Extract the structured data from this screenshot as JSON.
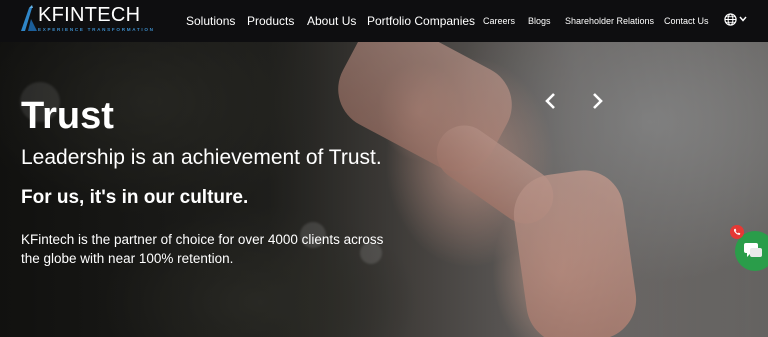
{
  "brand": {
    "name": "KFINTECH",
    "tagline": "EXPERIENCE TRANSFORMATION",
    "accent": "#3c8cc8"
  },
  "nav": {
    "items": [
      {
        "label": "Solutions"
      },
      {
        "label": "Products"
      },
      {
        "label": "About Us"
      },
      {
        "label": "Portfolio Companies"
      },
      {
        "label": "Careers"
      },
      {
        "label": "Blogs"
      },
      {
        "label": "Shareholder Relations"
      },
      {
        "label": "Contact Us"
      }
    ],
    "language_icon": "globe-icon"
  },
  "hero": {
    "title": "Trust",
    "subtitle": "Leadership is an achievement of Trust.",
    "emphasis": "For us, it's in our culture.",
    "description": "KFintech is the partner of choice for over 4000 clients across the globe with near 100% retention.",
    "prev_icon": "chevron-left-icon",
    "next_icon": "chevron-right-icon"
  },
  "chat": {
    "icon": "chat-icon",
    "badge_icon": "phone-icon",
    "color": "#2a9d4a",
    "badge_color": "#e53935"
  }
}
